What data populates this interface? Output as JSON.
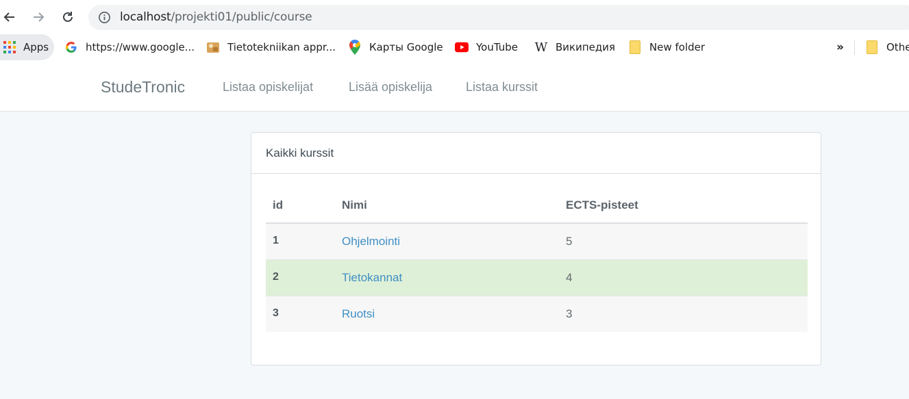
{
  "browser": {
    "url_host": "localhost",
    "url_path": "/projekti01/public/course",
    "bookmarks": [
      {
        "label": "Apps",
        "icon": "apps-grid-icon"
      },
      {
        "label": "https://www.google...",
        "icon": "google-icon"
      },
      {
        "label": "Tietotekniikan appr...",
        "icon": "bookmark-site-icon"
      },
      {
        "label": "Карты Google",
        "icon": "google-maps-icon"
      },
      {
        "label": "YouTube",
        "icon": "youtube-icon"
      },
      {
        "label": "Википедия",
        "icon": "wikipedia-icon"
      },
      {
        "label": "New folder",
        "icon": "folder-icon"
      },
      {
        "label": "Othe",
        "icon": "folder-icon"
      }
    ],
    "overflow_label": "»"
  },
  "navbar": {
    "brand": "StudeTronic",
    "links": [
      "Listaa opiskelijat",
      "Lisää opiskelija",
      "Listaa kurssit"
    ]
  },
  "panel": {
    "title": "Kaikki kurssit",
    "columns": [
      "id",
      "Nimi",
      "ECTS-pisteet"
    ],
    "rows": [
      {
        "id": "1",
        "name": "Ohjelmointi",
        "ects": "5"
      },
      {
        "id": "2",
        "name": "Tietokannat",
        "ects": "4"
      },
      {
        "id": "3",
        "name": "Ruotsi",
        "ects": "3"
      }
    ]
  },
  "colors": {
    "link": "#3f8fc4",
    "row_highlight": "#dff0d8",
    "page_bg": "#f4f8fb"
  }
}
